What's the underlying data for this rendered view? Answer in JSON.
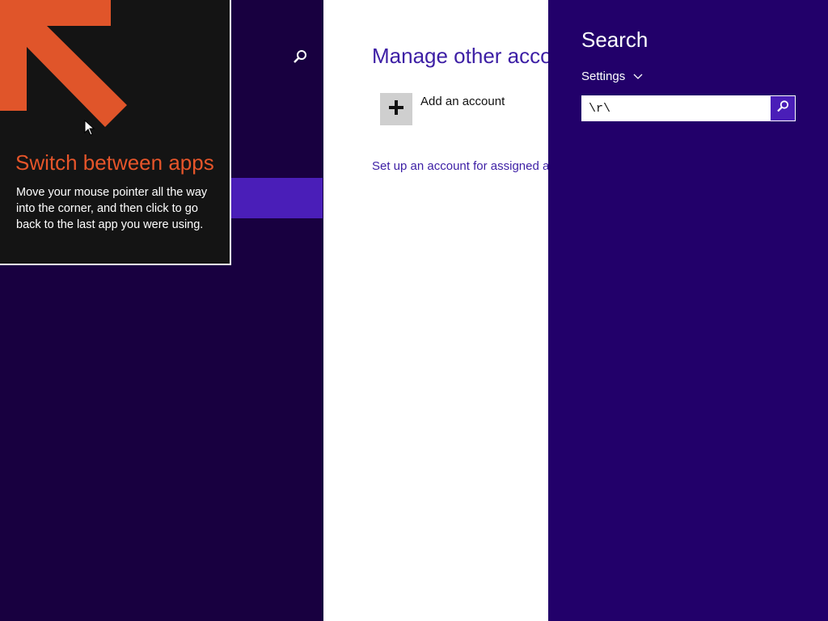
{
  "left_pane": {
    "search_icon": "search-icon"
  },
  "content": {
    "title": "Manage other acco",
    "add_account": {
      "icon": "plus-icon",
      "label": "Add an account"
    },
    "assigned_access_link": "Set up an account for assigned acc"
  },
  "search_charm": {
    "title": "Search",
    "scope": "Settings",
    "scope_icon": "chevron-down-icon",
    "query": "\\r\\",
    "button_icon": "search-icon"
  },
  "tip": {
    "title": "Switch between apps",
    "body": "Move your mouse pointer all the way into the corner, and then click to go back to the last app you were using.",
    "arrow_icon": "arrow-up-left-icon"
  },
  "colors": {
    "dark_purple": "#180040",
    "charm_purple": "#22006a",
    "accent_purple": "#4a1eb8",
    "tip_orange": "#e6552a"
  }
}
